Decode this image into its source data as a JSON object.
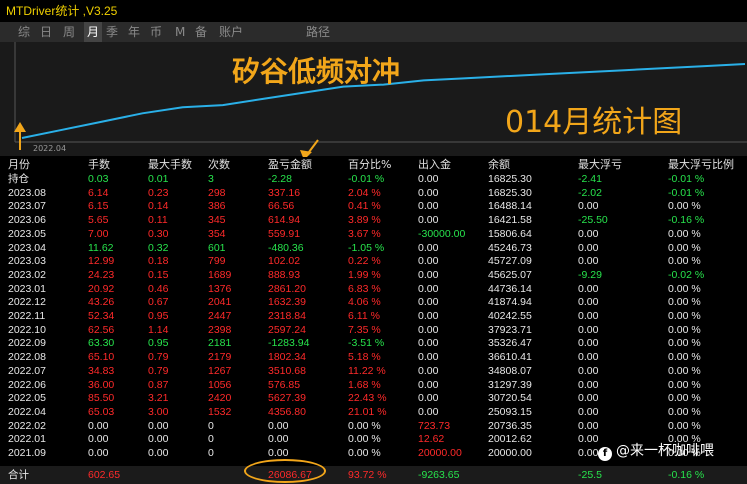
{
  "window": {
    "title": "MTDriver统计 ,V3.25"
  },
  "tabs": [
    {
      "label": "综"
    },
    {
      "label": "日"
    },
    {
      "label": "周"
    },
    {
      "label": "月",
      "active": true
    },
    {
      "label": "季"
    },
    {
      "label": "年"
    },
    {
      "label": "币"
    },
    {
      "label": "M"
    },
    {
      "label": "备"
    },
    {
      "label": "账户"
    },
    {
      "label": "路径"
    }
  ],
  "overlay": {
    "title": "矽谷低频对冲",
    "subtitle": "014月统计图"
  },
  "chart_data": {
    "type": "line",
    "xlabel": "",
    "x_tick_labels": [
      "2022.04"
    ],
    "series": [
      {
        "values": [
          0,
          4,
          8,
          12,
          15,
          16,
          19,
          22,
          25,
          26,
          28,
          29,
          30,
          31,
          32,
          33,
          34,
          35,
          36
        ]
      }
    ],
    "line_color": "#2ab0e8"
  },
  "table": {
    "columns": [
      "月份",
      "手数",
      "最大手数",
      "次数",
      "盈亏金额",
      "百分比%",
      "出入金",
      "余额",
      "最大浮亏",
      "最大浮亏比例"
    ],
    "rows": [
      [
        "持仓",
        "0.03",
        "0.01",
        "3",
        "-2.28",
        "-0.01 %",
        "0.00",
        "16825.30",
        "-2.41",
        "-0.01 %"
      ],
      [
        "2023.08",
        "6.14",
        "0.23",
        "298",
        "337.16",
        "2.04 %",
        "0.00",
        "16825.30",
        "-2.02",
        "-0.01 %"
      ],
      [
        "2023.07",
        "6.15",
        "0.14",
        "386",
        "66.56",
        "0.41 %",
        "0.00",
        "16488.14",
        "0.00",
        "0.00 %"
      ],
      [
        "2023.06",
        "5.65",
        "0.11",
        "345",
        "614.94",
        "3.89 %",
        "0.00",
        "16421.58",
        "-25.50",
        "-0.16 %"
      ],
      [
        "2023.05",
        "7.00",
        "0.30",
        "354",
        "559.91",
        "3.67 %",
        "-30000.00",
        "15806.64",
        "0.00",
        "0.00 %"
      ],
      [
        "2023.04",
        "11.62",
        "0.32",
        "601",
        "-480.36",
        "-1.05 %",
        "0.00",
        "45246.73",
        "0.00",
        "0.00 %"
      ],
      [
        "2023.03",
        "12.99",
        "0.18",
        "799",
        "102.02",
        "0.22 %",
        "0.00",
        "45727.09",
        "0.00",
        "0.00 %"
      ],
      [
        "2023.02",
        "24.23",
        "0.15",
        "1689",
        "888.93",
        "1.99 %",
        "0.00",
        "45625.07",
        "-9.29",
        "-0.02 %"
      ],
      [
        "2023.01",
        "20.92",
        "0.46",
        "1376",
        "2861.20",
        "6.83 %",
        "0.00",
        "44736.14",
        "0.00",
        "0.00 %"
      ],
      [
        "2022.12",
        "43.26",
        "0.67",
        "2041",
        "1632.39",
        "4.06 %",
        "0.00",
        "41874.94",
        "0.00",
        "0.00 %"
      ],
      [
        "2022.11",
        "52.34",
        "0.95",
        "2447",
        "2318.84",
        "6.11 %",
        "0.00",
        "40242.55",
        "0.00",
        "0.00 %"
      ],
      [
        "2022.10",
        "62.56",
        "1.14",
        "2398",
        "2597.24",
        "7.35 %",
        "0.00",
        "37923.71",
        "0.00",
        "0.00 %"
      ],
      [
        "2022.09",
        "63.30",
        "0.95",
        "2181",
        "-1283.94",
        "-3.51 %",
        "0.00",
        "35326.47",
        "0.00",
        "0.00 %"
      ],
      [
        "2022.08",
        "65.10",
        "0.79",
        "2179",
        "1802.34",
        "5.18 %",
        "0.00",
        "36610.41",
        "0.00",
        "0.00 %"
      ],
      [
        "2022.07",
        "34.83",
        "0.79",
        "1267",
        "3510.68",
        "11.22 %",
        "0.00",
        "34808.07",
        "0.00",
        "0.00 %"
      ],
      [
        "2022.06",
        "36.00",
        "0.87",
        "1056",
        "576.85",
        "1.68 %",
        "0.00",
        "31297.39",
        "0.00",
        "0.00 %"
      ],
      [
        "2022.05",
        "85.50",
        "3.21",
        "2420",
        "5627.39",
        "22.43 %",
        "0.00",
        "30720.54",
        "0.00",
        "0.00 %"
      ],
      [
        "2022.04",
        "65.03",
        "3.00",
        "1532",
        "4356.80",
        "21.01 %",
        "0.00",
        "25093.15",
        "0.00",
        "0.00 %"
      ],
      [
        "2022.02",
        "0.00",
        "0.00",
        "0",
        "0.00",
        "0.00 %",
        "723.73",
        "20736.35",
        "0.00",
        "0.00 %"
      ],
      [
        "2022.01",
        "0.00",
        "0.00",
        "0",
        "0.00",
        "0.00 %",
        "12.62",
        "20012.62",
        "0.00",
        "0.00 %"
      ],
      [
        "2021.09",
        "0.00",
        "0.00",
        "0",
        "0.00",
        "0.00 %",
        "20000.00",
        "20000.00",
        "0.00",
        "0.00 %"
      ]
    ],
    "row_colors": [
      [
        "w",
        "g",
        "g",
        "g",
        "g",
        "g",
        "w",
        "w",
        "g",
        "g"
      ],
      [
        "w",
        "r",
        "r",
        "r",
        "r",
        "r",
        "w",
        "w",
        "g",
        "g"
      ],
      [
        "w",
        "r",
        "r",
        "r",
        "r",
        "r",
        "w",
        "w",
        "w",
        "w"
      ],
      [
        "w",
        "r",
        "r",
        "r",
        "r",
        "r",
        "w",
        "w",
        "g",
        "g"
      ],
      [
        "w",
        "r",
        "r",
        "r",
        "r",
        "r",
        "g",
        "w",
        "w",
        "w"
      ],
      [
        "w",
        "g",
        "g",
        "g",
        "g",
        "g",
        "w",
        "w",
        "w",
        "w"
      ],
      [
        "w",
        "r",
        "r",
        "r",
        "r",
        "r",
        "w",
        "w",
        "w",
        "w"
      ],
      [
        "w",
        "r",
        "r",
        "r",
        "r",
        "r",
        "w",
        "w",
        "g",
        "g"
      ],
      [
        "w",
        "r",
        "r",
        "r",
        "r",
        "r",
        "w",
        "w",
        "w",
        "w"
      ],
      [
        "w",
        "r",
        "r",
        "r",
        "r",
        "r",
        "w",
        "w",
        "w",
        "w"
      ],
      [
        "w",
        "r",
        "r",
        "r",
        "r",
        "r",
        "w",
        "w",
        "w",
        "w"
      ],
      [
        "w",
        "r",
        "r",
        "r",
        "r",
        "r",
        "w",
        "w",
        "w",
        "w"
      ],
      [
        "w",
        "g",
        "g",
        "g",
        "g",
        "g",
        "w",
        "w",
        "w",
        "w"
      ],
      [
        "w",
        "r",
        "r",
        "r",
        "r",
        "r",
        "w",
        "w",
        "w",
        "w"
      ],
      [
        "w",
        "r",
        "r",
        "r",
        "r",
        "r",
        "w",
        "w",
        "w",
        "w"
      ],
      [
        "w",
        "r",
        "r",
        "r",
        "r",
        "r",
        "w",
        "w",
        "w",
        "w"
      ],
      [
        "w",
        "r",
        "r",
        "r",
        "r",
        "r",
        "w",
        "w",
        "w",
        "w"
      ],
      [
        "w",
        "r",
        "r",
        "r",
        "r",
        "r",
        "w",
        "w",
        "w",
        "w"
      ],
      [
        "w",
        "w",
        "w",
        "w",
        "w",
        "w",
        "r",
        "w",
        "w",
        "w"
      ],
      [
        "w",
        "w",
        "w",
        "w",
        "w",
        "w",
        "r",
        "w",
        "w",
        "w"
      ],
      [
        "w",
        "w",
        "w",
        "w",
        "w",
        "w",
        "r",
        "w",
        "w",
        "w"
      ]
    ],
    "total": [
      "合计",
      "602.65",
      "",
      "",
      "26086.67",
      "93.72 %",
      "-9263.65",
      "",
      "-25.5",
      "-0.16 %"
    ],
    "total_colors": [
      "w",
      "r",
      "w",
      "w",
      "r",
      "r",
      "g",
      "w",
      "g",
      "g"
    ]
  },
  "watermark": {
    "text": "@来一杯咖啡喂",
    "icon": "weibo-icon"
  },
  "colors": {
    "accent": "#f2a61a",
    "profit": "#ff2a2a",
    "loss": "#27e34c",
    "line": "#2ab0e8"
  }
}
